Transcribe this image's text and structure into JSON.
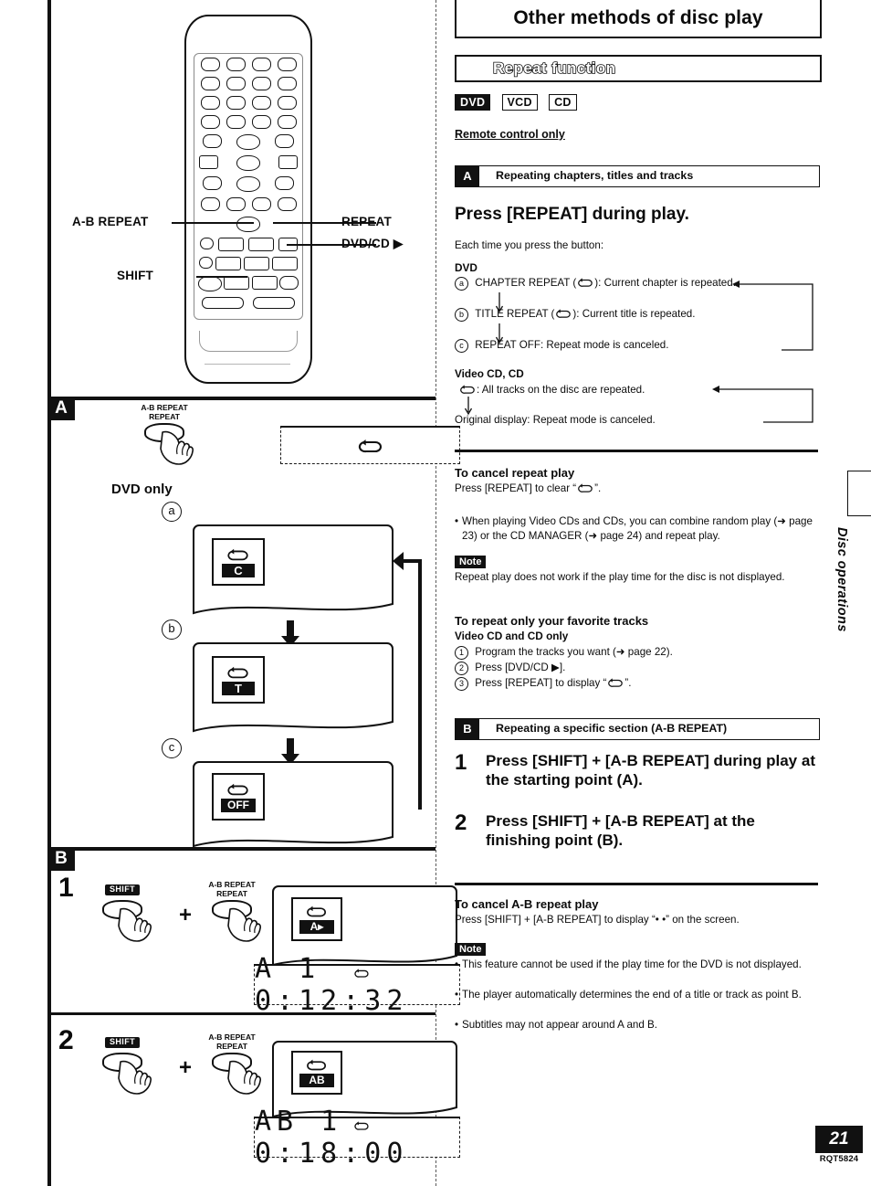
{
  "page": {
    "number": "21",
    "doc_code": "RQT5824",
    "side_tab_text": "Disc operations"
  },
  "right": {
    "title": "Other methods of disc play",
    "band_title": "Repeat function",
    "disc_tags": [
      {
        "label": "DVD",
        "filled": true
      },
      {
        "label": "VCD",
        "filled": false
      },
      {
        "label": "CD",
        "filled": false
      }
    ],
    "remote_only": "Remote control only",
    "section_a": {
      "chip": "A",
      "heading": "Repeating chapters, titles and tracks",
      "instruction": "Press [REPEAT] during play.",
      "each_time": "Each time you press the button:",
      "dvd_label": "DVD",
      "dvd_items": [
        {
          "marker": "a",
          "text": "CHAPTER REPEAT (",
          "after": "):  Current chapter is repeated."
        },
        {
          "marker": "b",
          "text": "TITLE REPEAT (",
          "after": "):  Current title is repeated."
        },
        {
          "marker": "c",
          "text": "REPEAT OFF:  Repeat mode is canceled.",
          "after": ""
        }
      ],
      "videocd_label": "Video CD, CD",
      "videocd_line1": ":  All tracks on the disc are repeated.",
      "videocd_line2": "Original display:  Repeat mode is canceled.",
      "cancel_head": "To cancel repeat play",
      "cancel_text_before": "Press [REPEAT] to clear “",
      "cancel_text_after": "”.",
      "bullet_random": "When playing Video CDs and CDs, you can combine random play (➜ page 23) or the CD MANAGER (➜ page 24) and repeat play.",
      "note_label": "Note",
      "note_text": "Repeat play does not work if the play time for the disc is not displayed.",
      "fav_head": "To repeat only your favorite tracks",
      "fav_sub": "Video CD and CD only",
      "fav_steps": [
        {
          "marker": "1",
          "text": "Program the tracks you want (➜ page 22)."
        },
        {
          "marker": "2",
          "text": "Press [DVD/CD ▶]."
        },
        {
          "marker": "3",
          "text": "Press [REPEAT] to display “",
          "after": "”."
        }
      ]
    },
    "section_b": {
      "chip": "B",
      "heading": "Repeating a specific section (A-B REPEAT)",
      "steps": [
        {
          "num": "1",
          "text": "Press [SHIFT] + [A-B REPEAT] during play at the starting point (A)."
        },
        {
          "num": "2",
          "text": "Press [SHIFT] + [A-B REPEAT] at the finishing point (B)."
        }
      ],
      "cancel_head": "To cancel A-B repeat play",
      "cancel_text": "Press [SHIFT] + [A-B REPEAT] to display “• •” on the screen.",
      "note_label": "Note",
      "note_bullets": [
        "This feature cannot be used if the play time for the DVD is not displayed.",
        "The player automatically determines the end of a title or track as point B.",
        "Subtitles may not appear around A and B."
      ]
    }
  },
  "left": {
    "remote_callouts": [
      {
        "label": "A-B REPEAT",
        "side": "left"
      },
      {
        "label": "REPEAT",
        "side": "right"
      },
      {
        "label": "DVD/CD ▶",
        "side": "right"
      },
      {
        "label": "SHIFT",
        "side": "left"
      }
    ],
    "section_a": {
      "chip": "A",
      "button_caption_top": "A-B REPEAT",
      "button_caption_bottom": "REPEAT",
      "dvd_only": "DVD only",
      "states": [
        {
          "marker": "a",
          "osd": "C"
        },
        {
          "marker": "b",
          "osd": "T"
        },
        {
          "marker": "c",
          "osd": "OFF"
        }
      ]
    },
    "section_b": {
      "chip": "B",
      "plus": "+",
      "steps": [
        {
          "num": "1",
          "btn1_label": "SHIFT",
          "btn2_caption_top": "A-B REPEAT",
          "btn2_caption_bottom": "REPEAT",
          "osd": "A▸",
          "lcd": "A   1  0:12:32"
        },
        {
          "num": "2",
          "btn1_label": "SHIFT",
          "btn2_caption_top": "A-B REPEAT",
          "btn2_caption_bottom": "REPEAT",
          "osd": "AB",
          "lcd": "AB  1  0:18:00"
        }
      ]
    }
  },
  "icons": {
    "repeat_loop": "repeat-loop-icon",
    "arrow_down": "arrow-down-icon",
    "arrow_right": "arrow-right-icon",
    "hand_press": "hand-press-icon"
  }
}
